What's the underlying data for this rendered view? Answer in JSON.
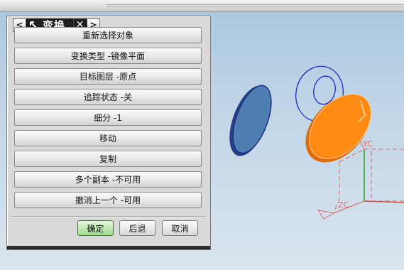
{
  "dialog": {
    "title": "变换",
    "nav_prev": "<",
    "nav_next": ">",
    "close": "✕",
    "menu": [
      {
        "label": "重新选择对象"
      },
      {
        "label": "变换类型 -镜像平面"
      },
      {
        "label": "目标图层 -原点"
      },
      {
        "label": "追踪状态 -关"
      },
      {
        "label": "细分 -1"
      },
      {
        "label": "移动"
      },
      {
        "label": "复制"
      },
      {
        "label": "多个副本 -不可用"
      },
      {
        "label": "撤消上一个 -可用"
      }
    ],
    "footer": {
      "ok": "确定",
      "back": "后退",
      "cancel": "取消"
    }
  },
  "viewport": {
    "axis_yc": "YC",
    "axis_zc": "ZC"
  },
  "colors": {
    "disc_blue": "#4f7fb2",
    "disc_orange": "#ff8a14",
    "wire_blue": "#1c26c8",
    "axis_red": "#d86a6a",
    "axis_green": "#2aa02a"
  }
}
